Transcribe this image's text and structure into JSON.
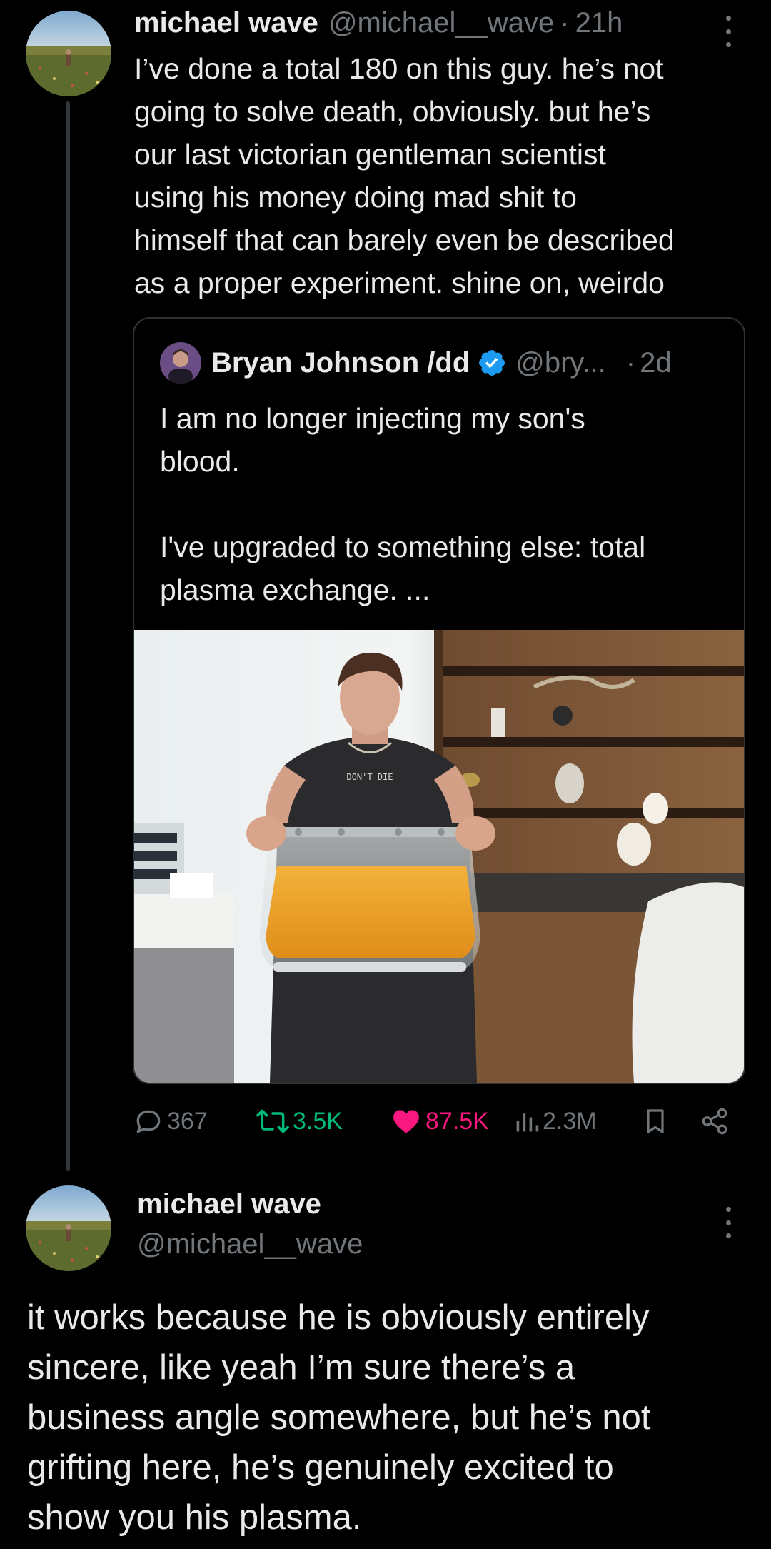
{
  "tweet1": {
    "display_name": "michael wave",
    "handle": "@michael__wave",
    "separator": "·",
    "time": "21h",
    "text": "I’ve done a total 180 on this guy. he’s not\ngoing to solve death, obviously. but he’s\nour last victorian gentleman scientist\nusing his money doing mad shit to\nhimself that can barely even be described\nas a proper experiment. shine on, weirdo",
    "avatar_icon": "meadow-photo-avatar",
    "more_icon": "more-vertical-icon"
  },
  "quote": {
    "display_name": "Bryan Johnson /dd",
    "verified_icon": "verified-badge-icon",
    "verified_color": "#1d9bf0",
    "handle": "@bry...",
    "separator": "·",
    "time": "2d",
    "text": "I am no longer injecting my son's\nblood.\n\nI've upgraded to something else: total\nplasma exchange. ...",
    "media_shirt_text": "DON'T DIE"
  },
  "actions": {
    "reply_icon": "reply-bubble-icon",
    "reply_count": "367",
    "repost_icon": "repost-icon",
    "repost_count": "3.5K",
    "repost_color": "#00ba7c",
    "like_icon": "heart-icon",
    "like_count": "87.5K",
    "like_color": "#f91880",
    "views_icon": "views-bar-icon",
    "views_count": "2.3M",
    "bookmark_icon": "bookmark-icon",
    "share_icon": "share-icon"
  },
  "tweet2": {
    "display_name": "michael wave",
    "handle": "@michael__wave",
    "text": "it works because he is obviously entirely\nsincere, like yeah I’m sure there’s a\nbusiness angle somewhere, but he’s not\ngrifting here, he’s genuinely excited to\nshow you his plasma.",
    "avatar_icon": "meadow-photo-avatar",
    "more_icon": "more-vertical-icon"
  },
  "colors": {
    "background": "#000000",
    "text_primary": "#e7e9ea",
    "text_secondary": "#71767b",
    "border": "#2f3336"
  }
}
